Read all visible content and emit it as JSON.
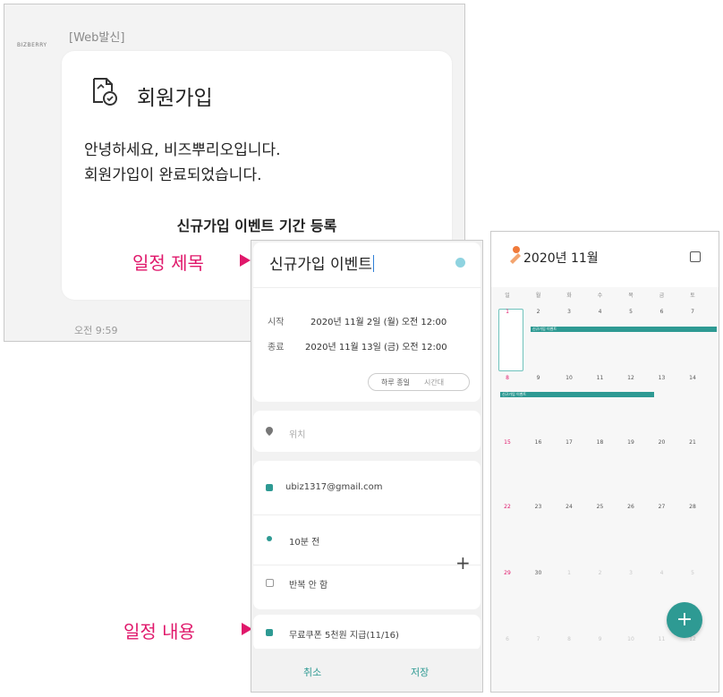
{
  "message": {
    "sender": "BIZBERRY",
    "tag": "[Web발신]",
    "title": "회원가입",
    "body_line1": "안녕하세요, 비즈뿌리오입니다.",
    "body_line2": "회원가입이 완료되었습니다.",
    "subtitle": "신규가입 이벤트 기간 등록",
    "time": "오전 9:59"
  },
  "annotations": {
    "title_label": "일정 제목",
    "content_label": "일정 내용"
  },
  "editor": {
    "title_value": "신규가입 이벤트",
    "start_label": "시작",
    "start_value": "2020년 11월 2일 (월) 오전 12:00",
    "end_label": "종료",
    "end_value": "2020년 11월 13일 (금) 오전 12:00",
    "allday_label": "하루 종일",
    "timezone_label": "시간대",
    "location_placeholder": "위치",
    "account": "ubiz1317@gmail.com",
    "reminder": "10분 전",
    "repeat": "반복 안 함",
    "memo": "무료쿠폰 5천원 지급(11/16)",
    "cancel": "취소",
    "save": "저장",
    "accent": "#2e9a93"
  },
  "calendar": {
    "title": "2020년 11월",
    "weekdays": [
      "일",
      "월",
      "화",
      "수",
      "목",
      "금",
      "토"
    ],
    "weeks": [
      [
        "1",
        "2",
        "3",
        "4",
        "5",
        "6",
        "7"
      ],
      [
        "8",
        "9",
        "10",
        "11",
        "12",
        "13",
        "14"
      ],
      [
        "15",
        "16",
        "17",
        "18",
        "19",
        "20",
        "21"
      ],
      [
        "22",
        "23",
        "24",
        "25",
        "26",
        "27",
        "28"
      ],
      [
        "29",
        "30",
        "1",
        "2",
        "3",
        "4",
        "5"
      ],
      [
        "6",
        "7",
        "8",
        "9",
        "10",
        "11",
        "12"
      ]
    ],
    "event_name": "신규가입 이벤트",
    "fab": "+"
  }
}
